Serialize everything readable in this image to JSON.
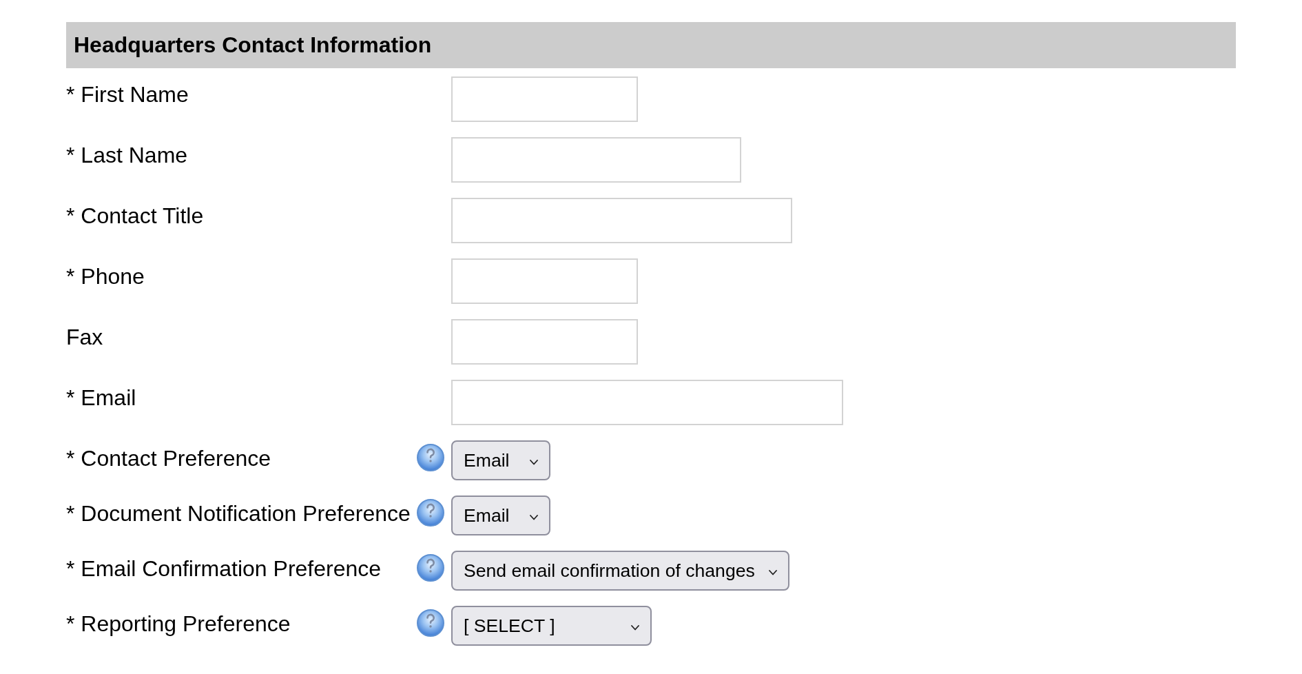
{
  "section": {
    "title": "Headquarters Contact Information"
  },
  "fields": [
    {
      "kind": "text",
      "label": "* First Name",
      "help": false
    },
    {
      "kind": "text",
      "label": "* Last Name",
      "help": false
    },
    {
      "kind": "text",
      "label": "* Contact Title",
      "help": false
    },
    {
      "kind": "text",
      "label": "* Phone",
      "help": false
    },
    {
      "kind": "text",
      "label": "Fax",
      "help": false
    },
    {
      "kind": "text",
      "label": "* Email",
      "help": false
    },
    {
      "kind": "select",
      "label": "* Contact Preference",
      "help": true,
      "value": "Email"
    },
    {
      "kind": "select",
      "label": "* Document Notification Preference",
      "help": true,
      "value": "Email"
    },
    {
      "kind": "select",
      "label": "* Email Confirmation Preference",
      "help": true,
      "value": "Send email confirmation of changes"
    },
    {
      "kind": "select",
      "label": "* Reporting Preference",
      "help": true,
      "value": "[ SELECT ]"
    }
  ]
}
